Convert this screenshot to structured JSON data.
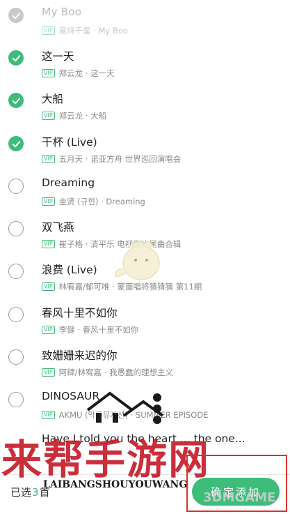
{
  "songs": [
    {
      "title": "My Boo",
      "sub": "易烊千玺 · My Boo",
      "state": "dim"
    },
    {
      "title": "这一天",
      "sub": "郑云龙 · 这一天",
      "state": "on"
    },
    {
      "title": "大船",
      "sub": "郑云龙 · 大船",
      "state": "on"
    },
    {
      "title": "干杯 (Live)",
      "sub": "五月天 · 诺亚方舟 世界巡回演唱会",
      "state": "on"
    },
    {
      "title": "Dreaming",
      "sub": "圭贤 (규현) · Dreaming",
      "state": "off"
    },
    {
      "title": "双飞燕",
      "sub": "崔子格 · 清平乐 电视剧片尾曲合辑",
      "state": "off"
    },
    {
      "title": "浪费 (Live)",
      "sub": "林宥嘉/郁可唯 · 蒙面唱将猜猜猜 第11期",
      "state": "off"
    },
    {
      "title": "春风十里不如你",
      "sub": "李健 · 春风十里不如你",
      "state": "off"
    },
    {
      "title": "致姗姗来迟的你",
      "sub": "阿肆/林宥嘉 · 我愚蠢的理想主义",
      "state": "off"
    },
    {
      "title": "DINOSAUR",
      "sub": "AKMU (악동뮤지션) · SUMMER EPISODE",
      "state": "off"
    },
    {
      "title": "Have I told you the heart ... the one...",
      "sub": "",
      "state": "hidden"
    }
  ],
  "vip_label": "VIP",
  "bottom": {
    "selected_prefix": "已选",
    "selected_count": "3",
    "selected_suffix": "首",
    "confirm_label": "确定添加"
  },
  "watermark": {
    "big": "来帮手游网",
    "small": "LAIBANGSHOUYOUWANG",
    "logo": "3DMGAME"
  },
  "colors": {
    "accent": "#3dbc7a",
    "watermark": "#c71d2b"
  }
}
